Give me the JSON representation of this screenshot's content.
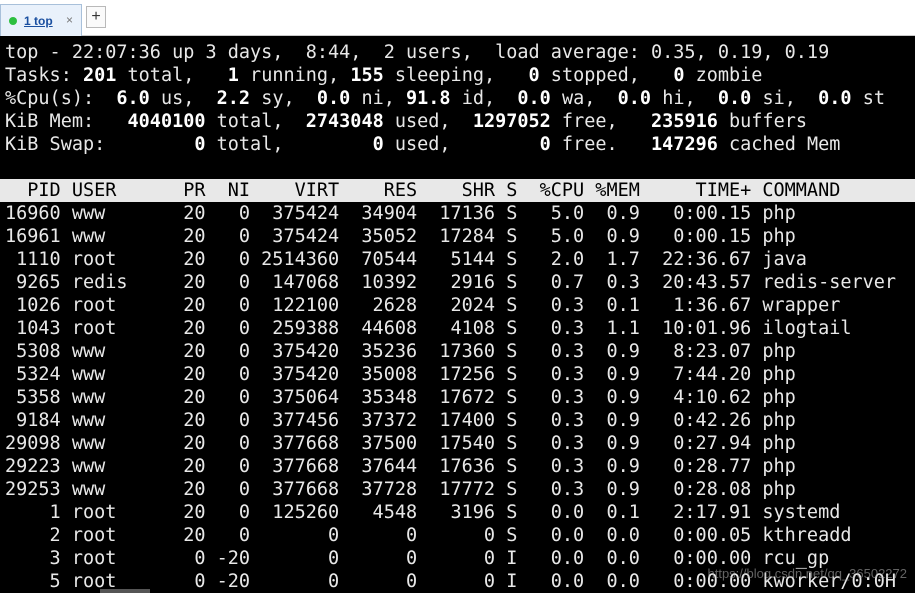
{
  "tabs": [
    {
      "label": "1 top",
      "close": "×"
    }
  ],
  "add_tab_label": "+",
  "summary": {
    "line1": "top - 22:07:36 up 3 days,  8:44,  2 users,  load average: 0.35, 0.19, 0.19",
    "tasks": {
      "prefix": "Tasks: ",
      "total": "201",
      "t1": " total,   ",
      "running": "1",
      "t2": " running, ",
      "sleeping": "155",
      "t3": " sleeping,   ",
      "stopped": "0",
      "t4": " stopped,   ",
      "zombie": "0",
      "t5": " zombie"
    },
    "cpu": {
      "prefix": "%Cpu(s):  ",
      "us": "6.0",
      "t1": " us,  ",
      "sy": "2.2",
      "t2": " sy,  ",
      "ni": "0.0",
      "t3": " ni, ",
      "id": "91.8",
      "t4": " id,  ",
      "wa": "0.0",
      "t5": " wa,  ",
      "hi": "0.0",
      "t6": " hi,  ",
      "si": "0.0",
      "t7": " si,  ",
      "st": "0.0",
      "t8": " st"
    },
    "mem": {
      "prefix": "KiB Mem:   ",
      "total": "4040100",
      "t1": " total,  ",
      "used": "2743048",
      "t2": " used,  ",
      "free": "1297052",
      "t3": " free,   ",
      "buffers": "235916",
      "t4": " buffers"
    },
    "swap": {
      "prefix": "KiB Swap:        ",
      "total": "0",
      "t1": " total,        ",
      "used": "0",
      "t2": " used,        ",
      "free": "0",
      "t3": " free.   ",
      "cached": "147296",
      "t4": " cached Mem"
    }
  },
  "process_header": "  PID USER      PR  NI    VIRT    RES    SHR S  %CPU %MEM     TIME+ COMMAND",
  "processes": [
    "16960 www       20   0  375424  34904  17136 S   5.0  0.9   0:00.15 php",
    "16961 www       20   0  375424  35052  17284 S   5.0  0.9   0:00.15 php",
    " 1110 root      20   0 2514360  70544   5144 S   2.0  1.7  22:36.67 java",
    " 9265 redis     20   0  147068  10392   2916 S   0.7  0.3  20:43.57 redis-server",
    " 1026 root      20   0  122100   2628   2024 S   0.3  0.1   1:36.67 wrapper",
    " 1043 root      20   0  259388  44608   4108 S   0.3  1.1  10:01.96 ilogtail",
    " 5308 www       20   0  375420  35236  17360 S   0.3  0.9   8:23.07 php",
    " 5324 www       20   0  375420  35008  17256 S   0.3  0.9   7:44.20 php",
    " 5358 www       20   0  375064  35348  17672 S   0.3  0.9   4:10.62 php",
    " 9184 www       20   0  377456  37372  17400 S   0.3  0.9   0:42.26 php",
    "29098 www       20   0  377668  37500  17540 S   0.3  0.9   0:27.94 php",
    "29223 www       20   0  377668  37644  17636 S   0.3  0.9   0:28.77 php",
    "29253 www       20   0  377668  37728  17772 S   0.3  0.9   0:28.08 php",
    "    1 root      20   0  125260   4548   3196 S   0.0  0.1   2:17.91 systemd",
    "    2 root      20   0       0      0      0 S   0.0  0.0   0:00.05 kthreadd",
    "    3 root       0 -20       0      0      0 I   0.0  0.0   0:00.00 rcu_gp",
    "    5 root       0 -20       0      0      0 I   0.0  0.0   0:00.00 kworker/0:0H"
  ],
  "watermark": "https://blog.csdn.net/qq_36502272"
}
